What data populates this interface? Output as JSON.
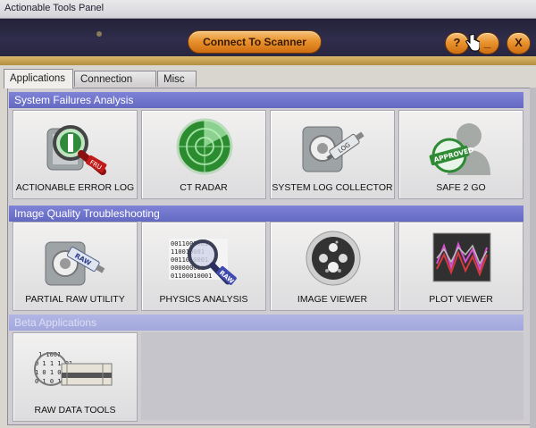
{
  "window": {
    "title": "Actionable Tools Panel"
  },
  "header": {
    "connect_label": "Connect To Scanner",
    "help_label": "?",
    "minimize_label": "_",
    "close_label": "X"
  },
  "tabs": [
    {
      "label": "Applications",
      "active": true
    },
    {
      "label": "Connection Info",
      "active": false
    },
    {
      "label": "Misc",
      "active": false
    }
  ],
  "sections": [
    {
      "title": "System Failures Analysis",
      "tools": [
        {
          "label": "ACTIONABLE ERROR LOG",
          "icon": "magnifier-fru-icon"
        },
        {
          "label": "CT RADAR",
          "icon": "radar-icon"
        },
        {
          "label": "SYSTEM LOG COLLECTOR",
          "icon": "syringe-log-icon"
        },
        {
          "label": "SAFE 2 GO",
          "icon": "approved-stamp-icon"
        }
      ]
    },
    {
      "title": "Image Quality Troubleshooting",
      "tools": [
        {
          "label": "PARTIAL RAW UTILITY",
          "icon": "syringe-raw-icon"
        },
        {
          "label": "PHYSICS ANALYSIS",
          "icon": "binary-magnifier-icon"
        },
        {
          "label": "IMAGE VIEWER",
          "icon": "phantom-image-icon"
        },
        {
          "label": "PLOT VIEWER",
          "icon": "plot-icon"
        }
      ]
    },
    {
      "title": "Beta Applications",
      "tools": [
        {
          "label": "RAW DATA TOOLS",
          "icon": "raw-data-icon"
        }
      ]
    }
  ],
  "icon_texts": {
    "fru": "FRU",
    "raw": "RAW",
    "approved": "APPROVED",
    "log": "LOG",
    "binary": [
      "0011001001",
      "110010001",
      "0011010001",
      "000000001",
      "01100010001"
    ],
    "rawdata": [
      "1  1001",
      "0 1 1 1  01",
      "1 0  1  0",
      "0 1  0  1"
    ]
  },
  "colors": {
    "header_bg": "#2a2842",
    "button_orange": "#e9932e",
    "section_blue": "#6b70c8",
    "section_beta": "#a6aade",
    "panel_bg": "#cfcdd1"
  }
}
